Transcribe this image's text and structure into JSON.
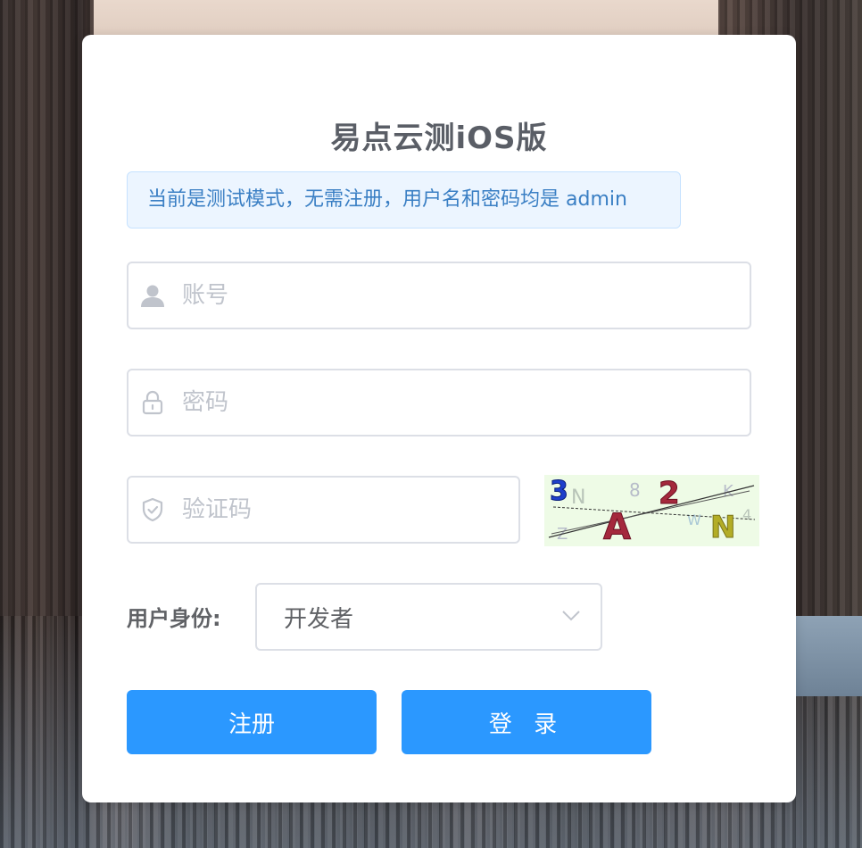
{
  "app": {
    "title": "易点云测iOS版"
  },
  "tip": {
    "text": "当前是测试模式，无需注册，用户名和密码均是 admin"
  },
  "form": {
    "username_placeholder": "账号",
    "password_placeholder": "密码",
    "captcha_placeholder": "验证码",
    "captcha_chars": [
      "3",
      "A",
      "2",
      "N"
    ],
    "role_label": "用户身份:",
    "role_value": "开发者"
  },
  "buttons": {
    "register": "注册",
    "login": "登 录"
  },
  "colors": {
    "primary": "#2b98ff",
    "tip_bg": "#ecf5ff",
    "tip_text": "#409eff",
    "title": "#5a5e66"
  },
  "icons": {
    "username": "user-icon",
    "password": "lock-icon",
    "captcha": "shield-icon",
    "select": "chevron-down-icon"
  }
}
